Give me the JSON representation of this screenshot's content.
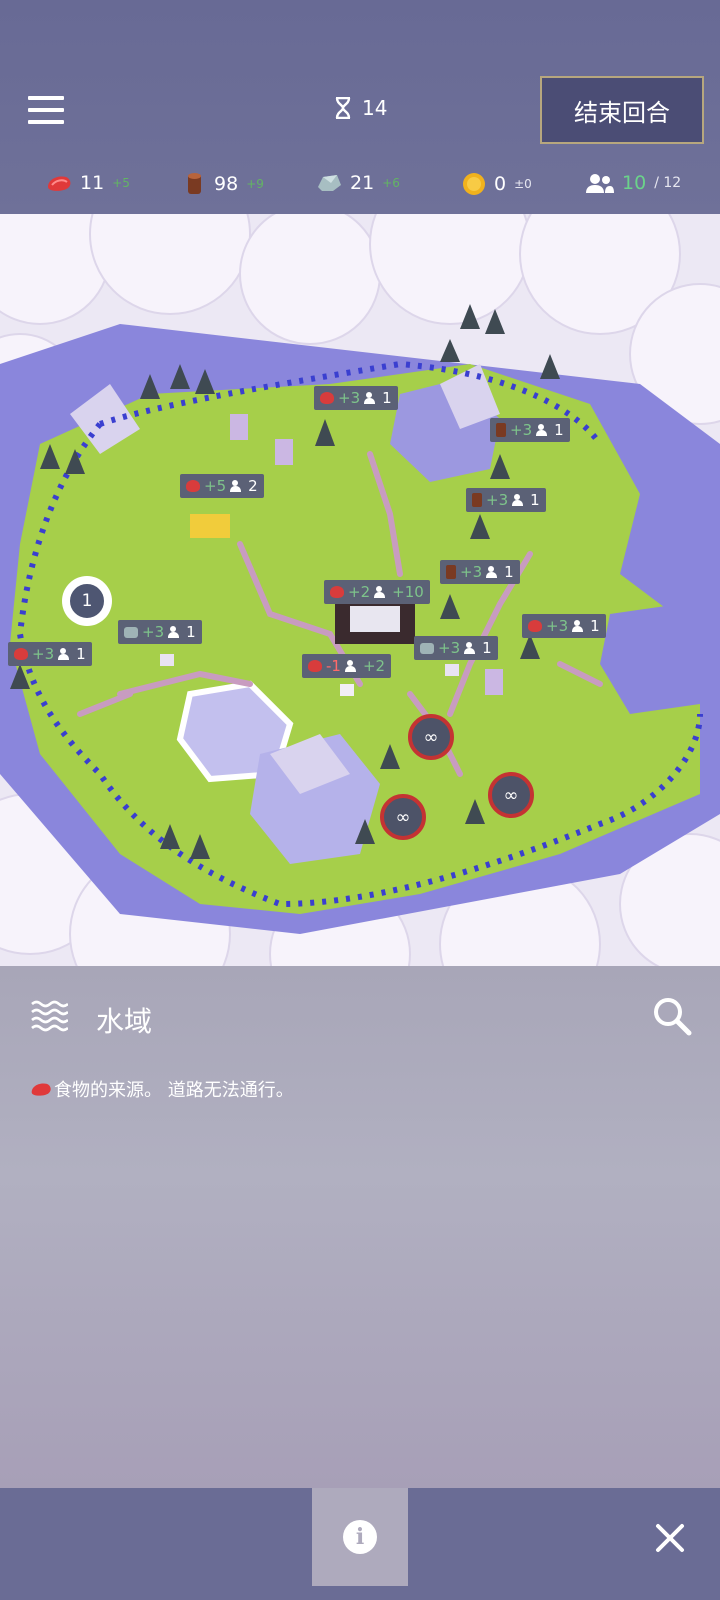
{
  "header": {
    "turn": "14",
    "end_turn_label": "结束回合"
  },
  "resources": [
    {
      "icon": "food-icon",
      "value": "11",
      "delta": "+5"
    },
    {
      "icon": "wood-icon",
      "value": "98",
      "delta": "+9"
    },
    {
      "icon": "stone-icon",
      "value": "21",
      "delta": "+6"
    },
    {
      "icon": "gold-icon",
      "value": "0",
      "delta": "±0"
    },
    {
      "icon": "population-icon",
      "value": "10",
      "max": "/ 12"
    }
  ],
  "map": {
    "unit_badge": "1",
    "infinity": "∞",
    "labels": [
      {
        "res": "food",
        "value": "+3",
        "pop": "1"
      },
      {
        "res": "wood",
        "value": "+3",
        "pop": "1"
      },
      {
        "res": "food",
        "value": "+5",
        "pop": "2"
      },
      {
        "res": "wood",
        "value": "+3",
        "pop": "1"
      },
      {
        "res": "wood",
        "value": "+3",
        "pop": "1"
      },
      {
        "res": "food",
        "value": "+2",
        "pop": "+10"
      },
      {
        "res": "stone",
        "value": "+3",
        "pop": "1"
      },
      {
        "res": "food",
        "value": "+3",
        "pop": "1"
      },
      {
        "res": "food",
        "value": "+3",
        "pop": "1"
      },
      {
        "res": "stone",
        "value": "+3",
        "pop": "1"
      },
      {
        "res": "food",
        "value": "-1",
        "pop": "+2"
      }
    ]
  },
  "panel": {
    "title": "水域",
    "description": "食物的来源。 道路无法通行。"
  },
  "colors": {
    "bar": "#6a6c95",
    "grass": "#a6cf4a",
    "water": "#9c98e0",
    "border": "#3a3fd0",
    "label_bg": "#5b6176",
    "accent_gold": "#b7a77e"
  }
}
